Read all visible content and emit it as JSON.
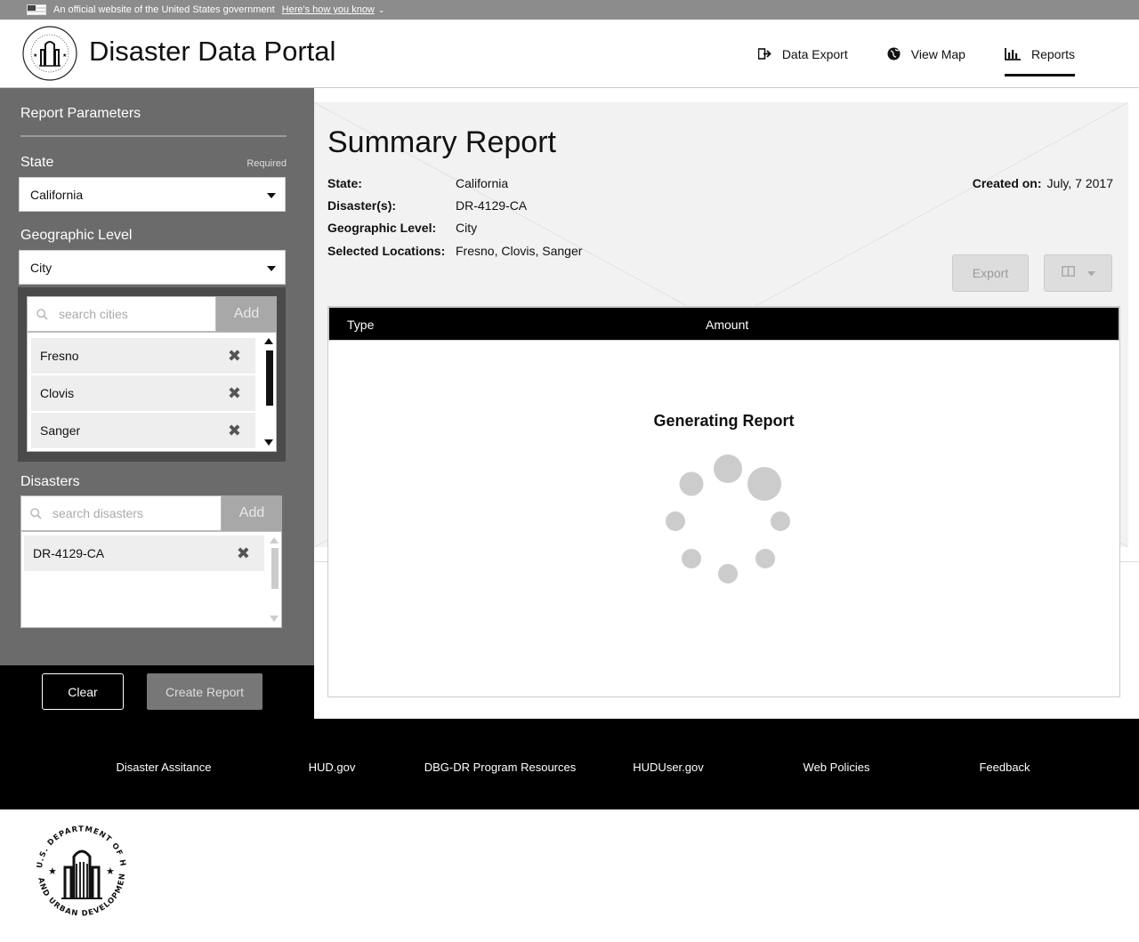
{
  "gov_banner": {
    "text": "An official website of the United States government",
    "link": "Here's how you know"
  },
  "header": {
    "title": "Disaster Data Portal",
    "logo_text": "U.S. DEPARTMENT OF HOUSING AND URBAN DEVELOPMENT",
    "nav": [
      {
        "label": "Data Export",
        "icon": "export-icon"
      },
      {
        "label": "View Map",
        "icon": "globe-icon"
      },
      {
        "label": "Reports",
        "icon": "bar-chart-icon",
        "active": true
      }
    ]
  },
  "sidebar": {
    "title": "Report Parameters",
    "state": {
      "label": "State",
      "required": "Required",
      "value": "California"
    },
    "geo": {
      "label": "Geographic Level",
      "value": "City"
    },
    "cities": {
      "placeholder": "search cities",
      "add_label": "Add",
      "items": [
        "Fresno",
        "Clovis",
        "Sanger"
      ]
    },
    "disasters": {
      "label": "Disasters",
      "placeholder": "search disasters",
      "add_label": "Add",
      "items": [
        "DR-4129-CA"
      ]
    },
    "clear_label": "Clear",
    "create_label": "Create Report"
  },
  "report": {
    "title": "Summary Report",
    "state_label": "State:",
    "state_value": "California",
    "disasters_label": "Disaster(s):",
    "disasters_value": "DR-4129-CA",
    "geo_label": "Geographic Level:",
    "geo_value": "City",
    "locations_label": "Selected Locations:",
    "locations_value": "Fresno, Clovis, Sanger",
    "created_label": "Created on:",
    "created_value": "July, 7 2017",
    "export_label": "Export",
    "table": {
      "headers": [
        "Type",
        "Amount"
      ],
      "status": "Generating Report"
    }
  },
  "footer": {
    "links": [
      "Disaster Assitance",
      "HUD.gov",
      "DBG-DR Program Resources",
      "HUDUser.gov",
      "Web Policies",
      "Feedback"
    ]
  }
}
